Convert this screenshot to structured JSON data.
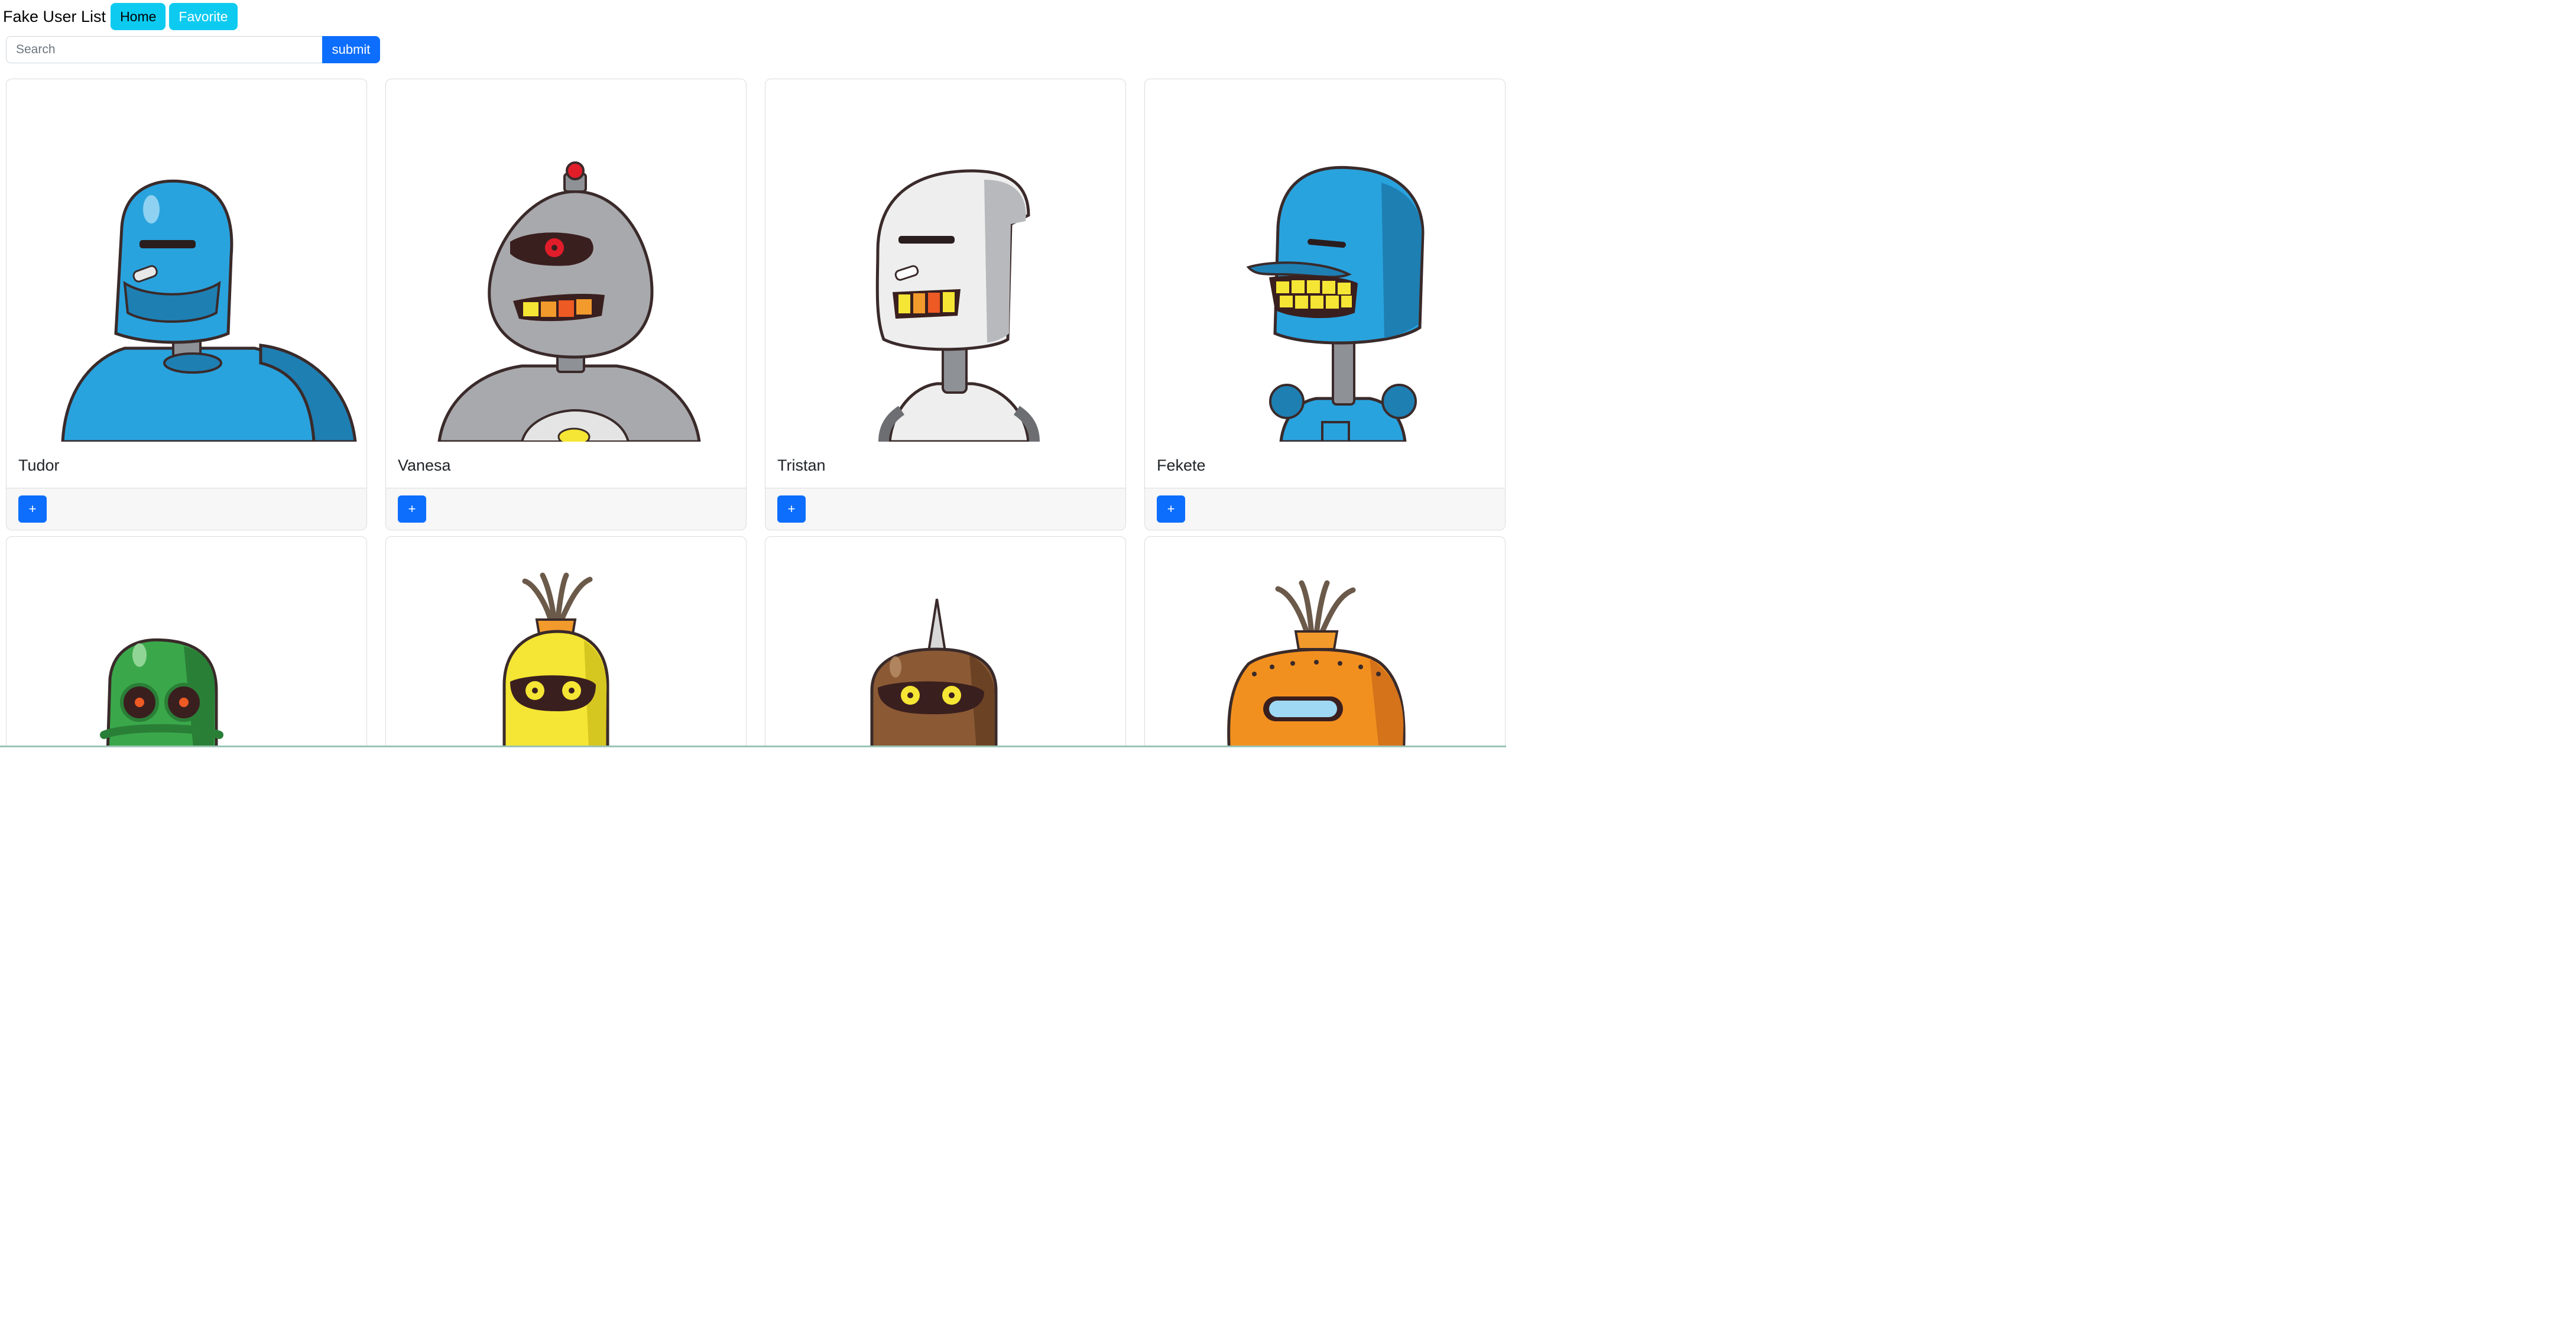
{
  "navbar": {
    "brand": "Fake User List",
    "home_label": "Home",
    "favorite_label": "Favorite"
  },
  "search": {
    "placeholder": "Search",
    "value": "",
    "submit_label": "submit"
  },
  "users": [
    {
      "name": "Tudor",
      "add_label": "+"
    },
    {
      "name": "Vanesa",
      "add_label": "+"
    },
    {
      "name": "Tristan",
      "add_label": "+"
    },
    {
      "name": "Fekete",
      "add_label": "+"
    },
    {
      "name": "",
      "add_label": "+"
    },
    {
      "name": "",
      "add_label": "+"
    },
    {
      "name": "",
      "add_label": "+"
    },
    {
      "name": "",
      "add_label": "+"
    }
  ],
  "colors": {
    "accent_info": "#0dcaf0",
    "accent_primary": "#0d6efd",
    "robot_blue": "#29a3de",
    "robot_gray": "#a8a9ad",
    "robot_white": "#eeeeee",
    "robot_green": "#3aa84a",
    "robot_yellow": "#f5e534",
    "robot_brown": "#8b5a34",
    "robot_orange": "#f2901f"
  }
}
